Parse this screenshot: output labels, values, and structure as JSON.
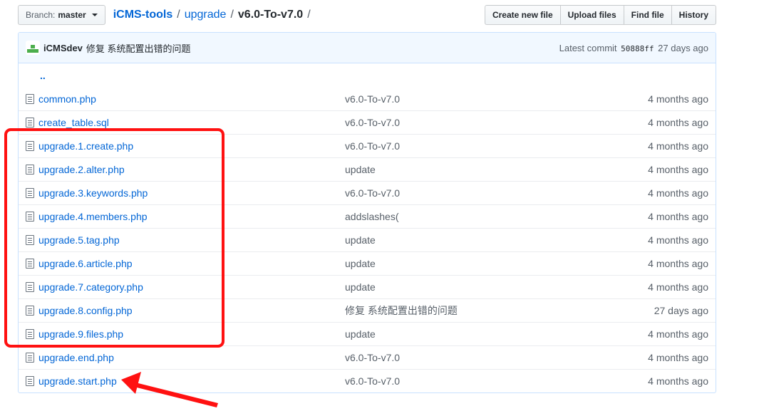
{
  "toolbar": {
    "branch_prefix": "Branch:",
    "branch_name": "master",
    "breadcrumb": {
      "repo": "iCMS-tools",
      "sep1": "/",
      "dir1": "upgrade",
      "sep2": "/",
      "current": "v6.0-To-v7.0",
      "sep3": "/"
    },
    "buttons": {
      "create": "Create new file",
      "upload": "Upload files",
      "find": "Find file",
      "history": "History"
    }
  },
  "commit": {
    "author": "iCMSdev",
    "message": "修复 系统配置出错的问题",
    "latest_label": "Latest commit",
    "sha": "50888ff",
    "age": "27 days ago"
  },
  "parent_link": "..",
  "files": [
    {
      "name": "common.php",
      "message": "v6.0-To-v7.0",
      "age": "4 months ago"
    },
    {
      "name": "create_table.sql",
      "message": "v6.0-To-v7.0",
      "age": "4 months ago"
    },
    {
      "name": "upgrade.1.create.php",
      "message": "v6.0-To-v7.0",
      "age": "4 months ago"
    },
    {
      "name": "upgrade.2.alter.php",
      "message": "update",
      "age": "4 months ago"
    },
    {
      "name": "upgrade.3.keywords.php",
      "message": "v6.0-To-v7.0",
      "age": "4 months ago"
    },
    {
      "name": "upgrade.4.members.php",
      "message": "addslashes(",
      "age": "4 months ago"
    },
    {
      "name": "upgrade.5.tag.php",
      "message": "update",
      "age": "4 months ago"
    },
    {
      "name": "upgrade.6.article.php",
      "message": "update",
      "age": "4 months ago"
    },
    {
      "name": "upgrade.7.category.php",
      "message": "update",
      "age": "4 months ago"
    },
    {
      "name": "upgrade.8.config.php",
      "message": "修复 系统配置出错的问题",
      "age": "27 days ago"
    },
    {
      "name": "upgrade.9.files.php",
      "message": "update",
      "age": "4 months ago"
    },
    {
      "name": "upgrade.end.php",
      "message": "v6.0-To-v7.0",
      "age": "4 months ago"
    },
    {
      "name": "upgrade.start.php",
      "message": "v6.0-To-v7.0",
      "age": "4 months ago"
    }
  ],
  "annotation_color": "#ff1111",
  "link_color": "#0366d6"
}
